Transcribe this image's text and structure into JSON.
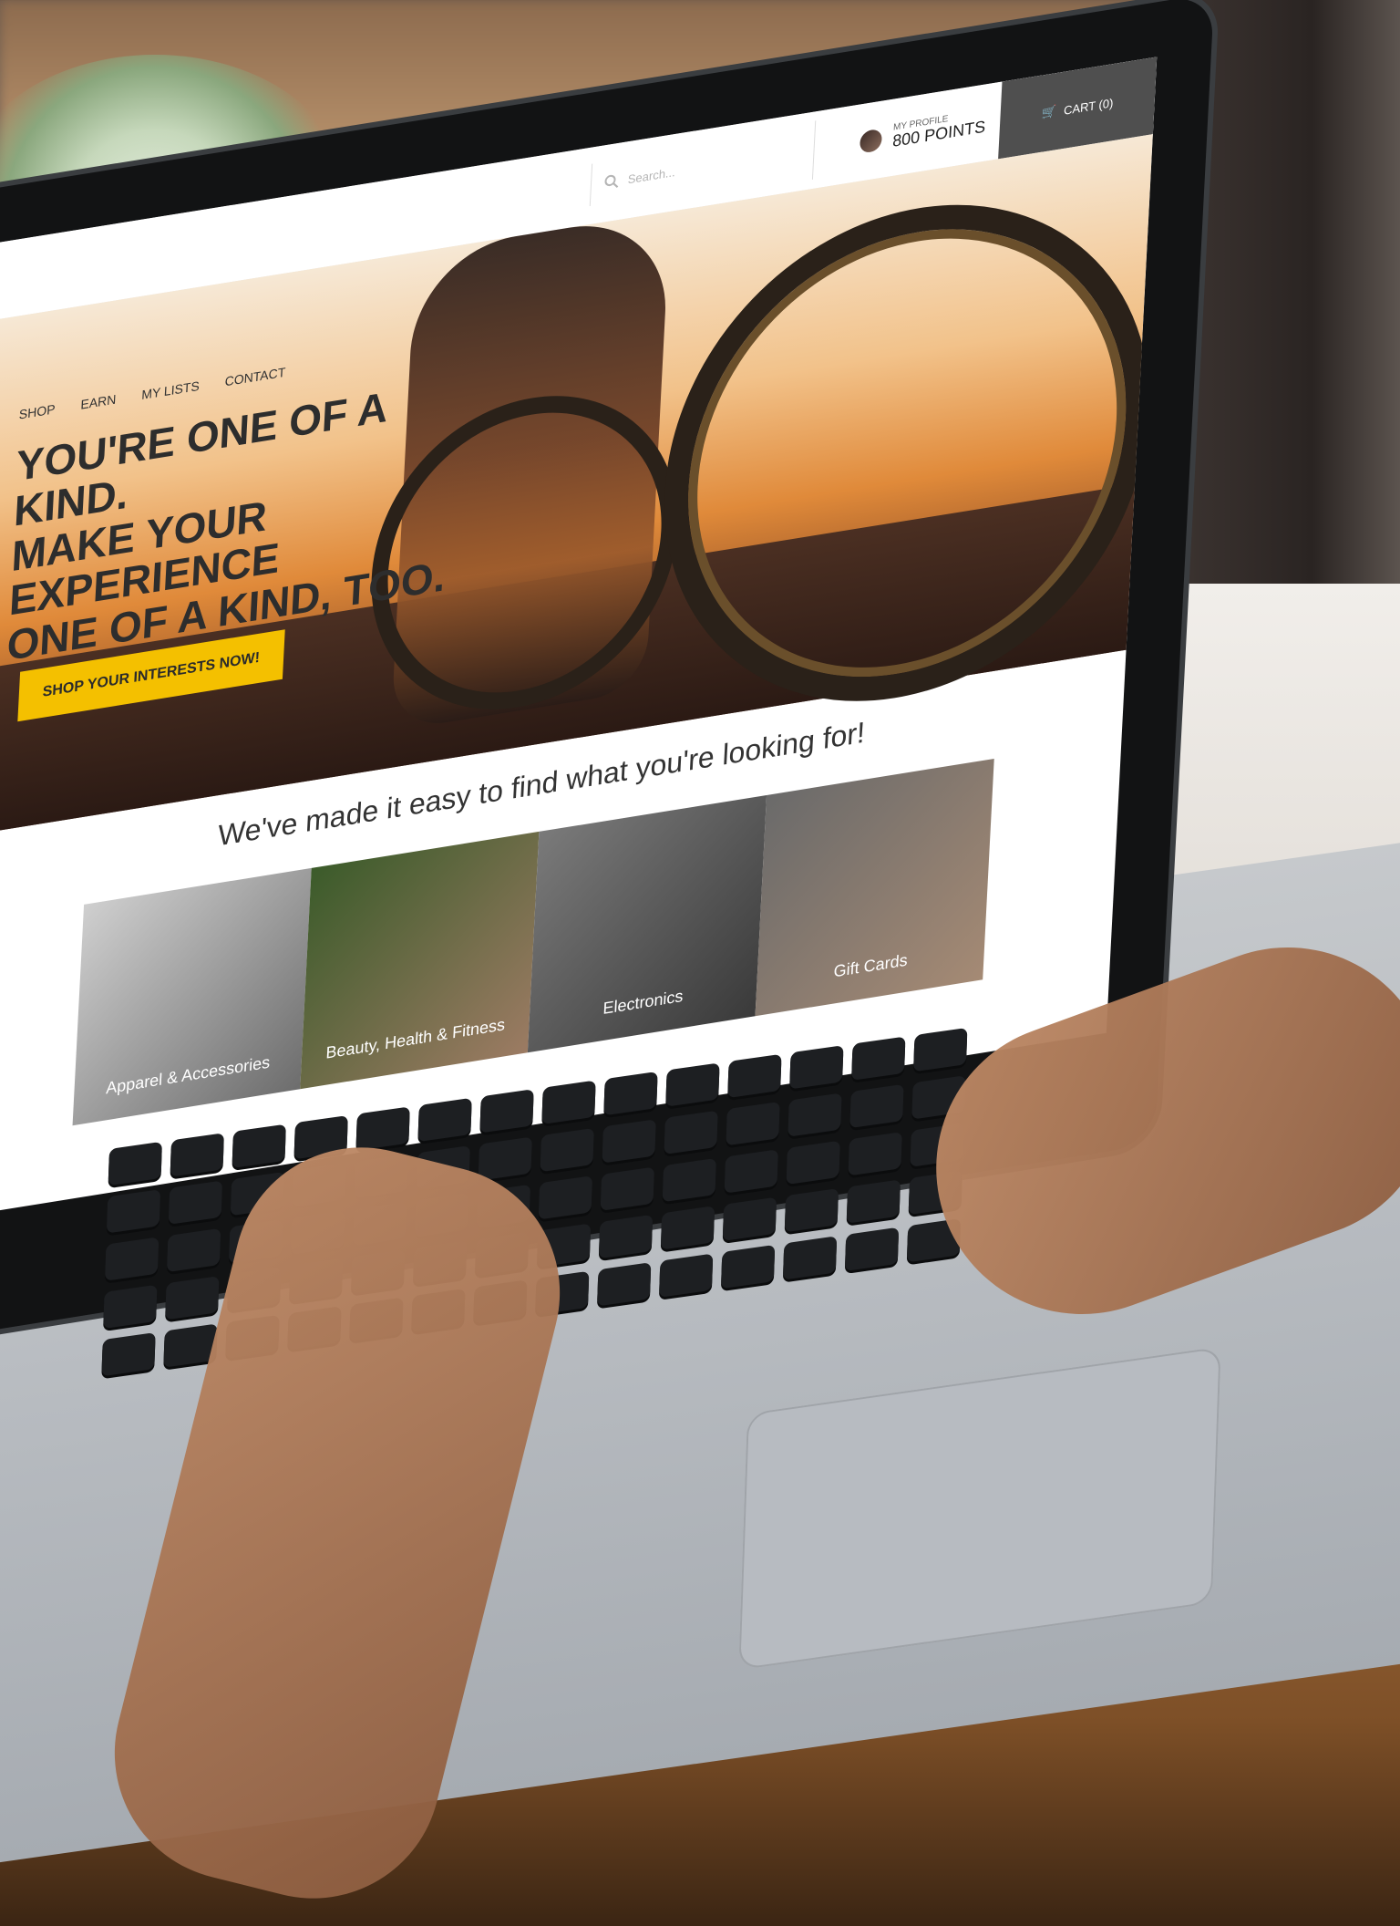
{
  "header": {
    "search_placeholder": "Search...",
    "profile_label": "MY PROFILE",
    "points": "800 POINTS",
    "cart": "CART (0)"
  },
  "nav": {
    "items": [
      "SHOP",
      "EARN",
      "MY LISTS",
      "CONTACT"
    ]
  },
  "hero": {
    "lines": [
      "YOU'RE ONE OF A KIND.",
      "MAKE YOUR EXPERIENCE",
      "ONE OF A KIND, TOO."
    ],
    "cta": "SHOP YOUR INTERESTS NOW!"
  },
  "section": {
    "title": "We've made it easy to find what you're looking for!",
    "categories": [
      "Apparel & Accessories",
      "Beauty, Health & Fitness",
      "Electronics",
      "Gift Cards"
    ]
  },
  "colors": {
    "accent": "#f4c000",
    "cart_bg": "#4f4f4f"
  }
}
